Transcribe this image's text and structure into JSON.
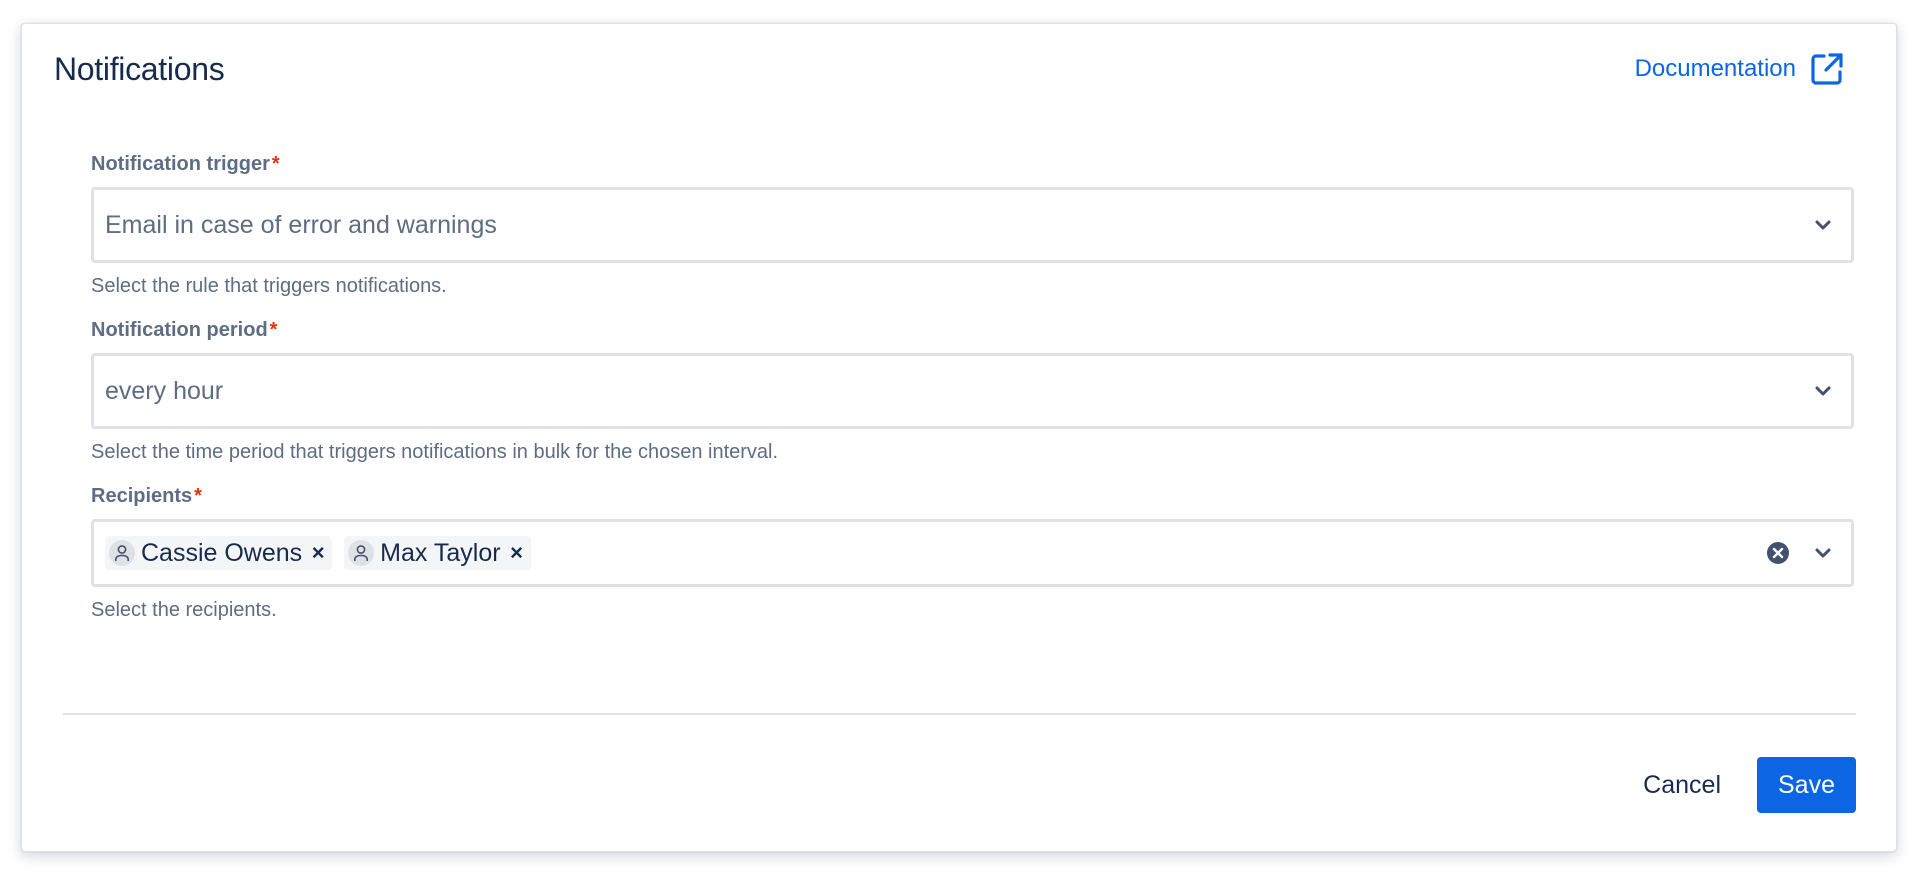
{
  "header": {
    "title": "Notifications",
    "documentation_label": "Documentation"
  },
  "fields": {
    "trigger": {
      "label": "Notification trigger",
      "required_mark": "*",
      "value": "Email in case of error and warnings",
      "helper": "Select the rule that triggers notifications."
    },
    "period": {
      "label": "Notification period",
      "required_mark": "*",
      "value": "every hour",
      "helper": "Select the time period that triggers notifications in bulk for the chosen interval."
    },
    "recipients": {
      "label": "Recipients",
      "required_mark": "*",
      "tags": [
        {
          "name": "Cassie Owens",
          "remove": "×"
        },
        {
          "name": "Max Taylor",
          "remove": "×"
        }
      ],
      "helper": "Select the recipients."
    }
  },
  "footer": {
    "cancel_label": "Cancel",
    "save_label": "Save"
  },
  "colors": {
    "primary": "#0c66e4",
    "text": "#172b4d",
    "subtle_text": "#5e6c84",
    "required": "#de350b",
    "border": "#dfe1e6"
  },
  "icons": {
    "documentation": "external-link-icon",
    "dropdown": "chevron-down-icon",
    "avatar": "user-icon",
    "clear": "clear-circle-icon"
  }
}
